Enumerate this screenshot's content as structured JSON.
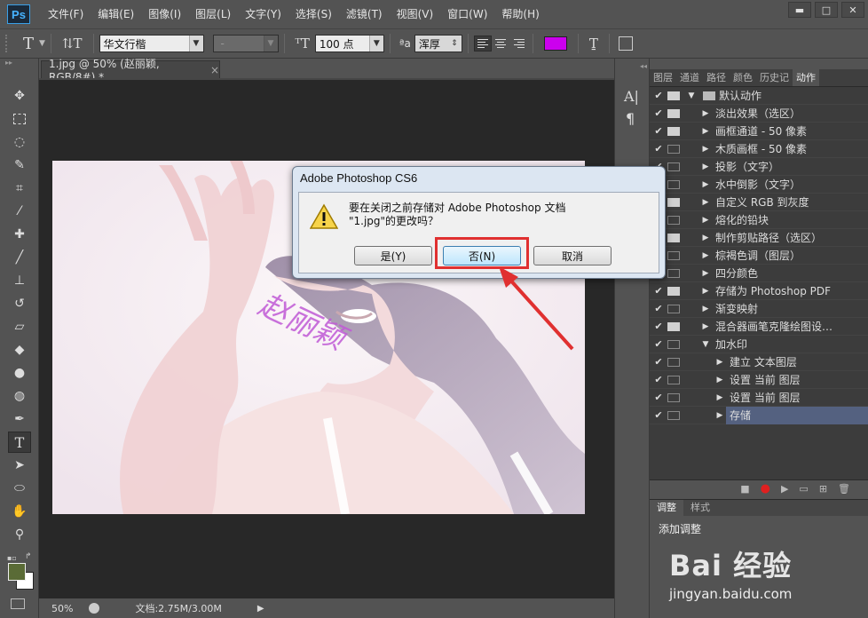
{
  "app": {
    "logo": "Ps"
  },
  "menu": [
    "文件(F)",
    "编辑(E)",
    "图像(I)",
    "图层(L)",
    "文字(Y)",
    "选择(S)",
    "滤镜(T)",
    "视图(V)",
    "窗口(W)",
    "帮助(H)"
  ],
  "window_controls": {
    "minimize": "▬",
    "maximize": "□",
    "close": "✕"
  },
  "options_bar": {
    "font_family": "华文行楷",
    "font_style": "-",
    "font_size": "100 点",
    "antialias": "浑厚",
    "text_color": "#cc00ee"
  },
  "document_tab": {
    "title": "1.jpg @ 50% (赵丽颖, RGB/8#) *",
    "close": "×"
  },
  "watermark_text": "赵丽颖",
  "status": {
    "zoom": "50%",
    "doc_info": "文档:2.75M/3.00M"
  },
  "dialog": {
    "title": "Adobe Photoshop CS6",
    "message_line1": "要在关闭之前存储对 Adobe Photoshop 文档",
    "message_line2": "\"1.jpg\"的更改吗？",
    "yes": "是(Y)",
    "no": "否(N)",
    "cancel": "取消"
  },
  "panel": {
    "tabs": [
      "图层",
      "通道",
      "路径",
      "颜色",
      "历史记",
      "动作"
    ],
    "active_tab": "动作",
    "actions": [
      {
        "label": "默认动作",
        "dialog": true,
        "arrow": "▼",
        "indent": 0,
        "folder": true
      },
      {
        "label": "淡出效果（选区）",
        "dialog": true,
        "arrow": "▶",
        "indent": 1
      },
      {
        "label": "画框通道 - 50 像素",
        "dialog": true,
        "arrow": "▶",
        "indent": 1
      },
      {
        "label": "木质画框 - 50 像素",
        "dialog": false,
        "arrow": "▶",
        "indent": 1
      },
      {
        "label": "投影（文字）",
        "dialog": false,
        "arrow": "▶",
        "indent": 1
      },
      {
        "label": "水中倒影（文字）",
        "dialog": false,
        "arrow": "▶",
        "indent": 1
      },
      {
        "label": "自定义 RGB 到灰度",
        "dialog": true,
        "arrow": "▶",
        "indent": 1
      },
      {
        "label": "熔化的铅块",
        "dialog": false,
        "arrow": "▶",
        "indent": 1
      },
      {
        "label": "制作剪贴路径（选区）",
        "dialog": true,
        "arrow": "▶",
        "indent": 1
      },
      {
        "label": "棕褐色调（图层）",
        "dialog": false,
        "arrow": "▶",
        "indent": 1
      },
      {
        "label": "四分颜色",
        "dialog": false,
        "arrow": "▶",
        "indent": 1
      },
      {
        "label": "存储为 Photoshop PDF",
        "dialog": true,
        "arrow": "▶",
        "indent": 1
      },
      {
        "label": "渐变映射",
        "dialog": false,
        "arrow": "▶",
        "indent": 1
      },
      {
        "label": "混合器画笔克隆绘图设…",
        "dialog": true,
        "arrow": "▶",
        "indent": 1
      },
      {
        "label": "加水印",
        "dialog": false,
        "arrow": "▼",
        "indent": 1
      },
      {
        "label": "建立 文本图层",
        "dialog": false,
        "arrow": "▶",
        "indent": 2
      },
      {
        "label": "设置 当前 图层",
        "dialog": false,
        "arrow": "▶",
        "indent": 2
      },
      {
        "label": "设置 当前 图层",
        "dialog": false,
        "arrow": "▶",
        "indent": 2
      },
      {
        "label": "存储",
        "dialog": false,
        "arrow": "▶",
        "indent": 2,
        "selected": true
      }
    ],
    "check": "✔"
  },
  "adjust": {
    "tabs": [
      "调整",
      "样式"
    ],
    "title": "添加调整"
  },
  "brand": {
    "big": "Bai 经验",
    "small": "jingyan.baidu.com"
  }
}
